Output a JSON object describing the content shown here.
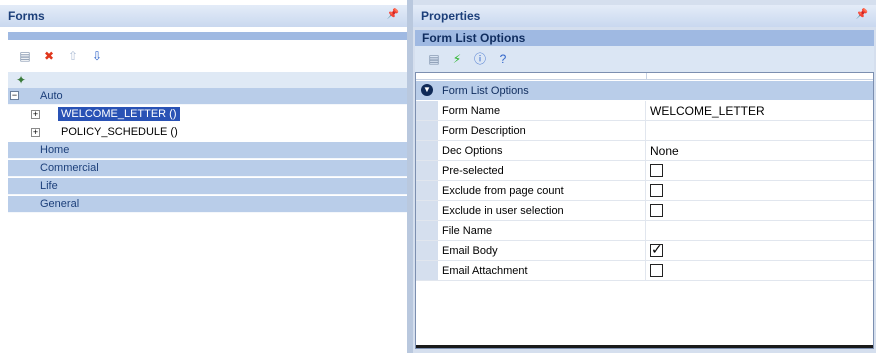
{
  "forms_panel": {
    "title": "Forms",
    "pin_icon": "pin-icon",
    "toolbar": [
      {
        "name": "properties-icon",
        "glyph": "▤",
        "color": "#7b8ea8"
      },
      {
        "name": "delete-icon",
        "glyph": "✖",
        "color": "#e0361c"
      },
      {
        "name": "move-up-icon",
        "glyph": "⇧",
        "color": "#b0bfd6"
      },
      {
        "name": "move-down-icon",
        "glyph": "⇩",
        "color": "#2e63c9"
      }
    ],
    "categories": [
      {
        "label": "Auto",
        "expanded": true
      },
      {
        "label": "Home"
      },
      {
        "label": "Commercial"
      },
      {
        "label": "Life"
      },
      {
        "label": "General"
      }
    ],
    "auto_forms": [
      {
        "label": "WELCOME_LETTER ()",
        "selected": true
      },
      {
        "label": "POLICY_SCHEDULE ()",
        "selected": false
      }
    ],
    "tree_expand_glyph": "+",
    "tree_collapse_glyph": "−"
  },
  "properties_panel": {
    "title": "Properties",
    "subheader": "Form List Options",
    "toolbar": [
      {
        "name": "categorized-icon",
        "glyph": "▤",
        "color": "#7b8ea8"
      },
      {
        "name": "events-icon",
        "glyph": "⚡",
        "color": "#2bb52b"
      },
      {
        "name": "info-icon",
        "glyph": "ⓘ",
        "color": "#2e63c9"
      },
      {
        "name": "help-icon",
        "glyph": "?",
        "color": "#2e63c9"
      }
    ],
    "category": "Form List Options",
    "rows": [
      {
        "name": "Form Name",
        "value": "WELCOME_LETTER",
        "type": "text"
      },
      {
        "name": "Form Description",
        "value": "",
        "type": "text"
      },
      {
        "name": "Dec Options",
        "value": "None",
        "type": "text"
      },
      {
        "name": "Pre-selected",
        "checked": false,
        "type": "checkbox"
      },
      {
        "name": "Exclude from page count",
        "checked": false,
        "type": "checkbox"
      },
      {
        "name": "Exclude in user selection",
        "checked": false,
        "type": "checkbox"
      },
      {
        "name": "File Name",
        "value": "",
        "type": "text"
      },
      {
        "name": "Email Body",
        "checked": true,
        "type": "checkbox"
      },
      {
        "name": "Email Attachment",
        "checked": false,
        "type": "checkbox"
      }
    ]
  },
  "colors": {
    "title_text": "#1c3f7a",
    "category_band": "#b9cde9",
    "selection": "#2952b5"
  }
}
